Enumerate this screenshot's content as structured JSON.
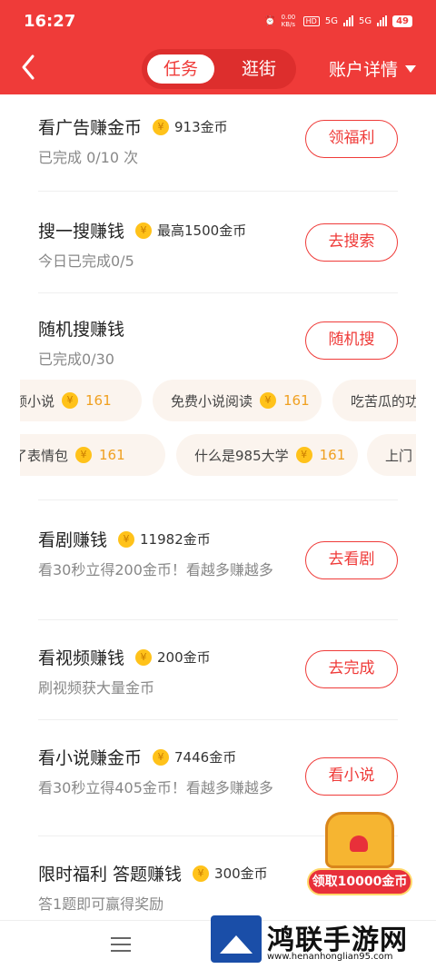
{
  "status": {
    "time": "16:27",
    "net_speed": "0.00\nKB/s",
    "hd": "HD",
    "sig1": "5G",
    "sig2": "5G",
    "battery": "49"
  },
  "nav": {
    "tab_active": "任务",
    "tab_other": "逛街",
    "account": "账户详情"
  },
  "tasks": [
    {
      "title": "看广告赚金币",
      "amount": "913金币",
      "desc": "已完成 0/10 次",
      "button": "领福利"
    },
    {
      "title": "搜一搜赚钱",
      "amount": "最高1500金币",
      "desc": "今日已完成0/5",
      "button": "去搜索"
    },
    {
      "title": "随机搜赚钱",
      "amount": "",
      "desc": "已完成0/30",
      "button": "随机搜"
    },
    {
      "title": "看剧赚钱",
      "amount": "11982金币",
      "desc": "看30秒立得200金币！看越多赚越多",
      "button": "去看剧"
    },
    {
      "title": "看视频赚钱",
      "amount": "200金币",
      "desc": "刷视频获大量金币",
      "button": "去完成"
    },
    {
      "title": "看小说赚金币",
      "amount": "7446金币",
      "desc": "看30秒立得405金币！看越多赚越多",
      "button": "看小说"
    },
    {
      "title": "限时福利 答题赚钱",
      "amount": "300金币",
      "desc": "答1题即可赢得奖励",
      "button": ""
    }
  ],
  "chips_row1": [
    {
      "text": "苏颜小说",
      "num": "161"
    },
    {
      "text": "免费小说阅读",
      "num": "161"
    },
    {
      "text": "吃苦瓜的功",
      "num": ""
    }
  ],
  "chips_row2": [
    {
      "text": "追了表情包",
      "num": "161"
    },
    {
      "text": "什么是985大学",
      "num": "161"
    },
    {
      "text": "上门",
      "num": ""
    }
  ],
  "promo": {
    "label": "领取10000金币"
  },
  "watermark": {
    "title": "鸿联手游网",
    "url": "www.henanhonglian95.com"
  },
  "colors": {
    "brand": "#ef3b39",
    "coin": "#ffc21a",
    "chip_bg": "#fbf4ee"
  }
}
